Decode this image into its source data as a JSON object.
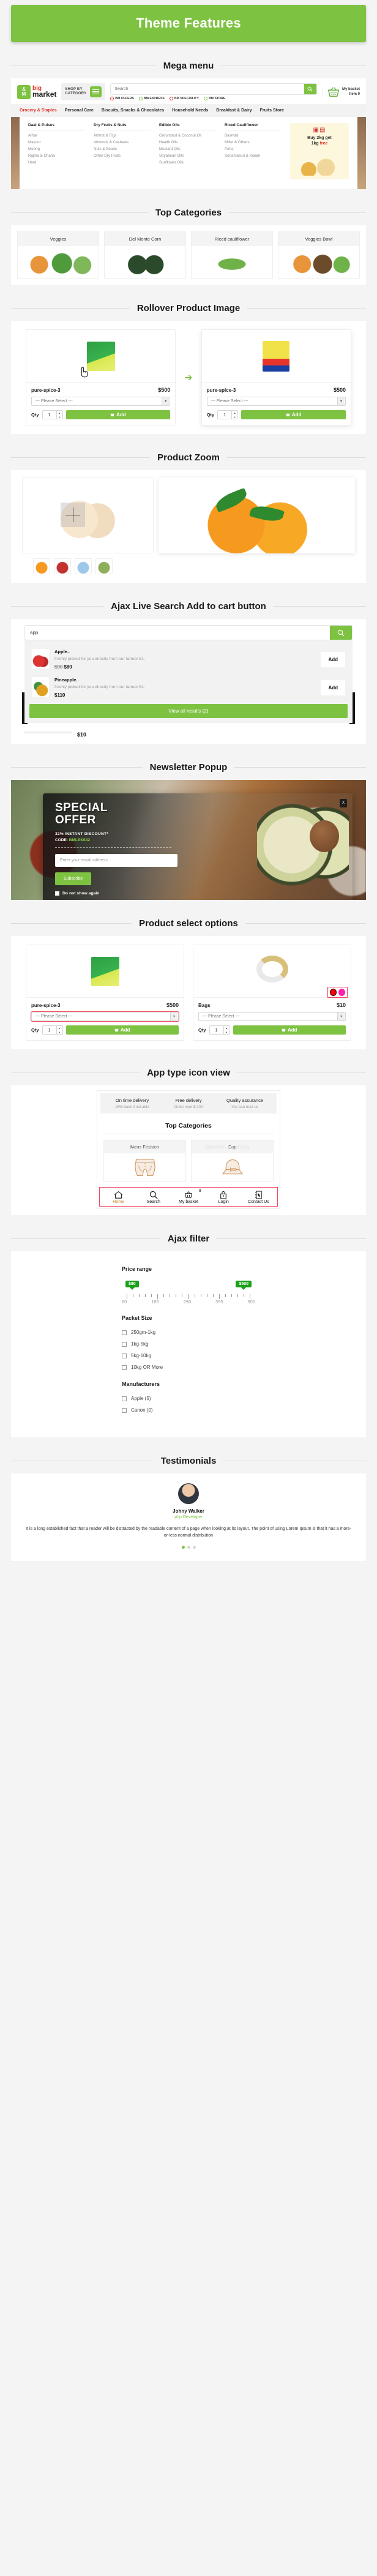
{
  "banner": {
    "title": "Theme Features"
  },
  "sections": {
    "mega_menu": "Mega menu",
    "top_categories": "Top Categories",
    "rollover": "Rollover Product Image",
    "product_zoom": "Product Zoom",
    "ajax_search": "Ajax Live Search Add to cart button",
    "newsletter": "Newsletter Popup",
    "select_options": "Product select options",
    "app_icon_view": "App type icon view",
    "ajax_filter": "Ajax filter",
    "testimonials": "Testimonials"
  },
  "header": {
    "logo_mark_top": "&",
    "logo_mark_bottom": "M",
    "logo_line1": "big",
    "logo_line2": "market",
    "shop_by_line1": "SHOP BY",
    "shop_by_line2": "CATEGORY",
    "search_placeholder": "Search",
    "badges": [
      {
        "label": "BM OFFERS",
        "color": "#d12f2f"
      },
      {
        "label": "BM EXPRESS",
        "color": "#7ec242"
      },
      {
        "label": "BM SPECIALITY",
        "color": "#d12f2f"
      },
      {
        "label": "BM STORE",
        "color": "#7ec242"
      }
    ],
    "basket_line1": "My basket",
    "basket_line2": "Item 0",
    "nav": [
      "Grocery & Staples",
      "Personal Care",
      "Biscuits, Snacks & Chocolates",
      "Household Needs",
      "Breakfast & Dairy",
      "Fruits Store"
    ],
    "nav_active_index": 0,
    "columns": [
      {
        "title": "Daal & Pulses",
        "links": [
          "Arhar",
          "Masoor",
          "Moong",
          "Rajma & Chana",
          "Urad"
        ]
      },
      {
        "title": "Dry Fruits & Nuts",
        "links": [
          "Akhrot & Figs",
          "Almonds & Cashews",
          "Nuts & Seeds",
          "Other Dry Fruits"
        ]
      },
      {
        "title": "Edible Oils",
        "links": [
          "Groundnut & Coconut Oil",
          "Health Oils",
          "Mustard Oils",
          "Soyabean Oils",
          "Sunflower Oils"
        ]
      },
      {
        "title": "Riced Cauliflower",
        "links": [
          "Basmati",
          "Millet & Others",
          "Poha",
          "Sonamasuri & Kolam"
        ]
      }
    ],
    "promo": {
      "line1": "Buy 2kg get",
      "line2": "1kg",
      "highlight": "free"
    }
  },
  "top_categories": [
    {
      "label": "Veggies"
    },
    {
      "label": "Del Monte Corn"
    },
    {
      "label": "Riced cauliflower"
    },
    {
      "label": "Veggies Bowl"
    }
  ],
  "rollover_products": [
    {
      "name": "pure-spice-3",
      "price": "$500",
      "select": "--- Please Select ---",
      "qty_label": "Qty",
      "qty": "1",
      "add": "Add"
    },
    {
      "name": "pure-spice-3",
      "price": "$500",
      "select": "--- Please Select ---",
      "qty_label": "Qty",
      "qty": "1",
      "add": "Add"
    }
  ],
  "ajax_search": {
    "value": "app",
    "results": [
      {
        "title": "Apple..",
        "desc": "freshly picked for you directly from our farmer.St..",
        "old_price": "$90",
        "price": "$80",
        "add": "Add"
      },
      {
        "title": "Pineapple..",
        "desc": "freshly picked for you directly from our farmer.St..",
        "old_price": "",
        "price": "$110",
        "add": "Add"
      }
    ],
    "view_all": "View all results (2)",
    "tail_price": "$10"
  },
  "newsletter": {
    "title_line1": "SPECIAL",
    "title_line2": "OFFER",
    "discount": "32% INSTANT DISCOUNT*",
    "code_label": "CODE:",
    "code_value": "BMLESS32",
    "email_placeholder": "Enter your email address",
    "subscribe": "Subscribe",
    "do_not_show": "Do not show again",
    "close": "X"
  },
  "select_option_products": [
    {
      "name": "pure-spice-3",
      "price": "$500",
      "select": "--- Please Select ---",
      "qty_label": "Qty",
      "qty": "1",
      "add": "Add",
      "highlight_select": true
    },
    {
      "name": "Bags",
      "price": "$10",
      "select": "--- Please Select ---",
      "qty_label": "Qty",
      "qty": "1",
      "add": "Add",
      "highlight_select": false,
      "swatches": [
        "#ff0000",
        "#ff1fae"
      ]
    }
  ],
  "app_view": {
    "features": [
      {
        "title": "On time delivery",
        "sub": "15% back if not able"
      },
      {
        "title": "Free delivery",
        "sub": "Order over $ 200"
      },
      {
        "title": "Quality assurance",
        "sub": "You can trust us"
      }
    ],
    "top_categories_title": "Top Categories",
    "cards": [
      {
        "label": "Mens Fashion"
      },
      {
        "label": "Cap"
      }
    ],
    "ghost_labels": [
      "Sunglass",
      "Women Fashion"
    ],
    "tabs": [
      {
        "label": "Home",
        "icon": "home-icon",
        "count": ""
      },
      {
        "label": "Search",
        "icon": "search-icon",
        "count": ""
      },
      {
        "label": "My basket",
        "icon": "basket-icon",
        "count": "0"
      },
      {
        "label": "Login",
        "icon": "lock-icon",
        "count": ""
      },
      {
        "label": "Contact Us",
        "icon": "contact-book-icon",
        "count": ""
      }
    ]
  },
  "ajax_filter": {
    "price_range_title": "Price range",
    "min_bubble": "$80",
    "max_bubble": "$500",
    "tick_labels": [
      "80",
      "185",
      "290",
      "395",
      "500"
    ],
    "packet_size_title": "Packet Size",
    "packet_sizes": [
      "250gm-1kg",
      "1kg-5kg",
      "5kg-10kg",
      "10kg OR More"
    ],
    "manufacturers_title": "Manufacturers",
    "manufacturers": [
      "Apple (5)",
      "Canon (0)"
    ]
  },
  "testimonials": {
    "name": "Johny Walker",
    "role": "php Developer",
    "body": "It is a long established fact that a reader will be distracted by the readable content of a page when looking at its layout. The point of using Lorem Ipsum is that it has a more-or-less normal distribution"
  },
  "colors": {
    "brand_green": "#7ec242",
    "accent_red": "#e03127",
    "highlight": "#f0465e"
  }
}
